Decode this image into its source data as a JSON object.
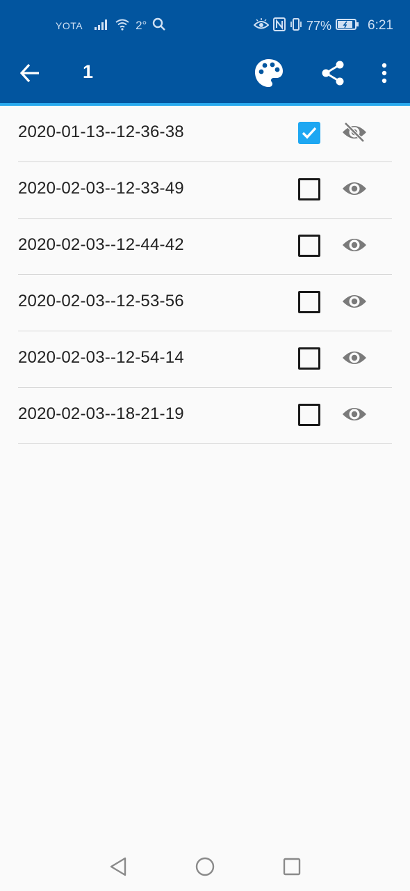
{
  "status_bar": {
    "carrier": "YOTA",
    "temperature": "2°",
    "battery": "77%",
    "time": "6:21",
    "icons": [
      "signal-icon",
      "wifi-icon",
      "search-icon",
      "eye-comfort-icon",
      "nfc-icon",
      "vibrate-icon",
      "battery-icon"
    ]
  },
  "app_bar": {
    "title": "1",
    "background": "#02559f",
    "accent": "#29a9ee",
    "icons": [
      "back-arrow-icon",
      "palette-icon",
      "share-icon",
      "more-vert-icon"
    ]
  },
  "list": {
    "items": [
      {
        "label": "2020-01-13--12-36-38",
        "checked": true,
        "visibility": "hidden"
      },
      {
        "label": "2020-02-03--12-33-49",
        "checked": false,
        "visibility": "visible"
      },
      {
        "label": "2020-02-03--12-44-42",
        "checked": false,
        "visibility": "visible"
      },
      {
        "label": "2020-02-03--12-53-56",
        "checked": false,
        "visibility": "visible"
      },
      {
        "label": "2020-02-03--12-54-14",
        "checked": false,
        "visibility": "visible"
      },
      {
        "label": "2020-02-03--18-21-19",
        "checked": false,
        "visibility": "visible"
      }
    ],
    "checkbox_color": "#1ea7f2",
    "icon_color": "#7a7a7a"
  },
  "nav_bar": {
    "icons": [
      "nav-back-icon",
      "nav-home-icon",
      "nav-recent-icon"
    ]
  }
}
